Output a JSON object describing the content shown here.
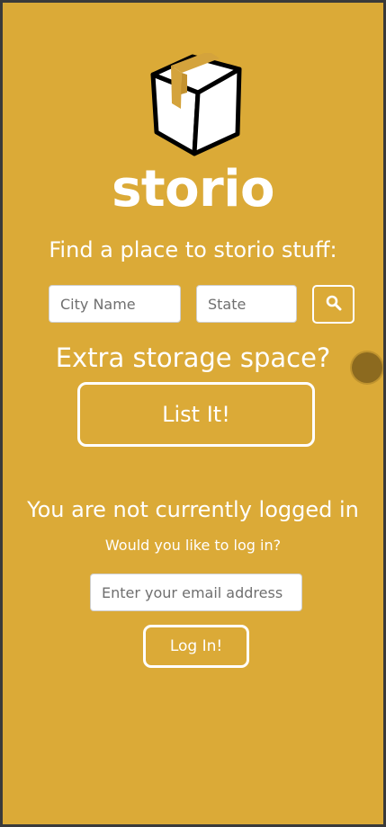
{
  "header": {
    "brand": "storio",
    "tagline": "Find a place to storio stuff:"
  },
  "search": {
    "city_placeholder": "City Name",
    "state_placeholder": "State",
    "search_icon": "search-icon"
  },
  "storage": {
    "heading": "Extra storage space?",
    "list_button_label": "List It!"
  },
  "login": {
    "status_text": "You are not currently logged in",
    "prompt_text": "Would you like to log in?",
    "email_placeholder": "Enter your email address",
    "button_label": "Log In!"
  },
  "colors": {
    "background": "#DBAA37",
    "text": "#FFFFFF",
    "status_dot": "#8C6A1F"
  }
}
